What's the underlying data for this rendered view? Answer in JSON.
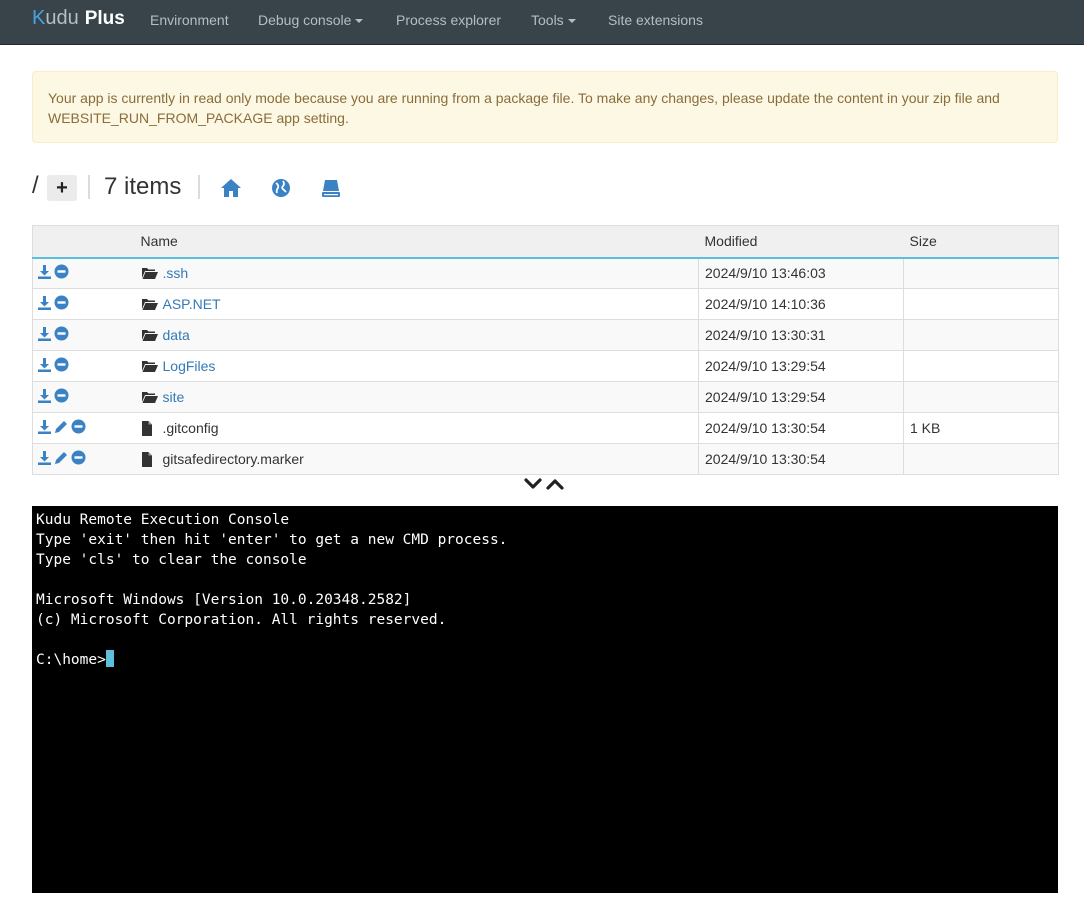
{
  "brand": {
    "kudu_k": "K",
    "kudu_rest": "udu",
    "plus": "Plus"
  },
  "nav": [
    {
      "label": "Environment"
    },
    {
      "label": "Debug console",
      "dropdown": true
    },
    {
      "label": "Process explorer"
    },
    {
      "label": "Tools",
      "dropdown": true
    },
    {
      "label": "Site extensions"
    }
  ],
  "alert": {
    "text": "Your app is currently in read only mode because you are running from a package file. To make any changes, please update the content in your zip file and WEBSITE_RUN_FROM_PACKAGE app setting."
  },
  "path": {
    "root": "/",
    "add_label": "+",
    "items_count": "7 items",
    "icons": [
      "home-icon",
      "globe-icon",
      "drive-icon"
    ]
  },
  "table": {
    "columns": {
      "name": "Name",
      "modified": "Modified",
      "size": "Size"
    },
    "rows": [
      {
        "name": ".ssh",
        "type": "folder",
        "modified": "2024/9/10 13:46:03",
        "size": ""
      },
      {
        "name": "ASP.NET",
        "type": "folder",
        "modified": "2024/9/10 14:10:36",
        "size": ""
      },
      {
        "name": "data",
        "type": "folder",
        "modified": "2024/9/10 13:30:31",
        "size": ""
      },
      {
        "name": "LogFiles",
        "type": "folder",
        "modified": "2024/9/10 13:29:54",
        "size": ""
      },
      {
        "name": "site",
        "type": "folder",
        "modified": "2024/9/10 13:29:54",
        "size": ""
      },
      {
        "name": ".gitconfig",
        "type": "file",
        "modified": "2024/9/10 13:30:54",
        "size": "1 KB"
      },
      {
        "name": "gitsafedirectory.marker",
        "type": "file",
        "modified": "2024/9/10 13:30:54",
        "size": ""
      }
    ]
  },
  "console": {
    "lines": [
      "Kudu Remote Execution Console",
      "Type 'exit' then hit 'enter' to get a new CMD process.",
      "Type 'cls' to clear the console",
      "",
      "Microsoft Windows [Version 10.0.20348.2582]",
      "(c) Microsoft Corporation. All rights reserved.",
      ""
    ],
    "prompt": "C:\\home>"
  },
  "colors": {
    "navbar": "#38434a",
    "link": "#337ab7",
    "accent": "#5bc0de",
    "icon_blue": "#3a82c4",
    "alert_bg": "#fcf8e3",
    "alert_text": "#8a6d3b"
  }
}
